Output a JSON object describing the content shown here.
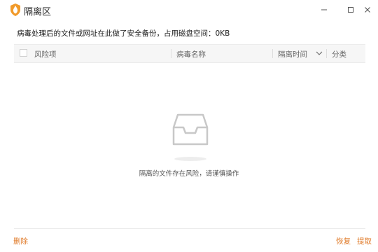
{
  "window": {
    "title": "隔离区",
    "app_icon": "shield-icon",
    "controls": {
      "minimize": "minimize-icon",
      "maximize": "maximize-icon",
      "close": "close-icon"
    }
  },
  "info": {
    "text": "病毒处理后的文件或网址在此做了安全备份，占用磁盘空间：0KB"
  },
  "table": {
    "columns": {
      "risk": "风险项",
      "virus": "病毒名称",
      "time": "隔离时间",
      "category": "分类"
    },
    "rows": []
  },
  "empty_state": {
    "icon": "empty-tray-icon",
    "message": "隔离的文件存在风险，请谨慎操作"
  },
  "footer": {
    "delete": "删除",
    "restore": "恢复",
    "extract": "提取"
  },
  "colors": {
    "accent": "#e07b2a",
    "header_bg": "#f6f6f6"
  }
}
